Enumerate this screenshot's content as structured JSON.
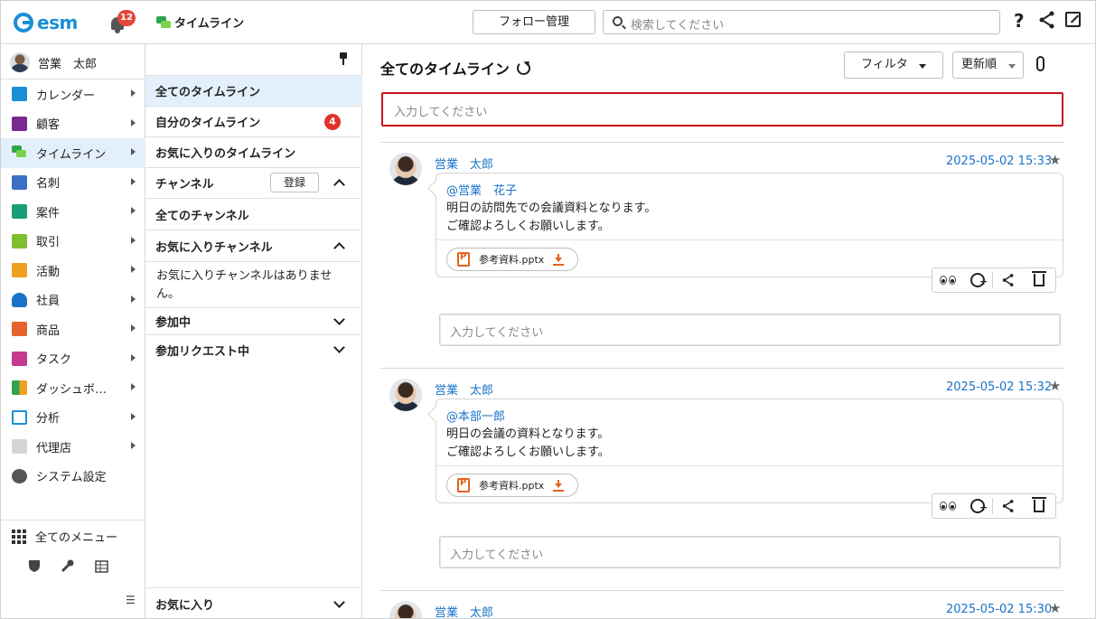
{
  "app": {
    "logo": "esm",
    "notification_count": "12",
    "page_title": "タイムライン"
  },
  "header": {
    "follow_button": "フォロー管理",
    "search_placeholder": "検索してください"
  },
  "sidebar": {
    "user_name": "営業　太郎",
    "items": [
      {
        "label": "カレンダー",
        "icon": "calendar-icon",
        "color": "#1a8fd6"
      },
      {
        "label": "顧客",
        "icon": "building-icon",
        "color": "#7a2a8c"
      },
      {
        "label": "タイムライン",
        "icon": "timeline-icon",
        "color": "#2ea44f"
      },
      {
        "label": "名刺",
        "icon": "business-card-icon",
        "color": "#3a6fc4"
      },
      {
        "label": "案件",
        "icon": "deal-icon",
        "color": "#1a9e7a"
      },
      {
        "label": "取引",
        "icon": "transaction-icon",
        "color": "#7fbf2e"
      },
      {
        "label": "活動",
        "icon": "activity-icon",
        "color": "#f0a020"
      },
      {
        "label": "社員",
        "icon": "employee-icon",
        "color": "#1a73c8"
      },
      {
        "label": "商品",
        "icon": "product-icon",
        "color": "#e5632a"
      },
      {
        "label": "タスク",
        "icon": "task-icon",
        "color": "#c43a8c"
      },
      {
        "label": "ダッシュボ…",
        "icon": "dashboard-icon",
        "color": "#2ea44f"
      },
      {
        "label": "分析",
        "icon": "analysis-icon",
        "color": "#1a8fd6"
      },
      {
        "label": "代理店",
        "icon": "agency-icon",
        "color": "#bdbdbd"
      },
      {
        "label": "システム設定",
        "icon": "settings-icon",
        "color": "#555555"
      }
    ],
    "all_menu": "全てのメニュー"
  },
  "midpanel": {
    "all_timeline": "全てのタイムライン",
    "my_timeline": "自分のタイムライン",
    "my_timeline_count": "4",
    "favorite_timeline": "お気に入りのタイムライン",
    "channel": "チャンネル",
    "register": "登録",
    "all_channels": "全てのチャンネル",
    "favorite_channels": "お気に入りチャンネル",
    "no_favorite_channels": "お気に入りチャンネルはありません。",
    "joined": "参加中",
    "join_requests": "参加リクエスト中",
    "favorites": "お気に入り"
  },
  "main": {
    "title": "全てのタイムライン",
    "filter": "フィルタ",
    "sort": "更新順",
    "post_placeholder": "入力してください",
    "reply_placeholder": "入力してください",
    "posts": [
      {
        "author": "営業　太郎",
        "date": "2025-05-02 15:33",
        "mention": "@営業　花子",
        "line1": "明日の訪問先での会議資料となります。",
        "line2": "ご確認よろしくお願いします。",
        "attachment": "参考資料.pptx"
      },
      {
        "author": "営業　太郎",
        "date": "2025-05-02 15:32",
        "mention": "@本部一郎",
        "line1": "明日の会議の資料となります。",
        "line2": "ご確認よろしくお願いします。",
        "attachment": "参考資料.pptx"
      },
      {
        "author": "営業　太郎",
        "date": "2025-05-02 15:30"
      }
    ]
  }
}
